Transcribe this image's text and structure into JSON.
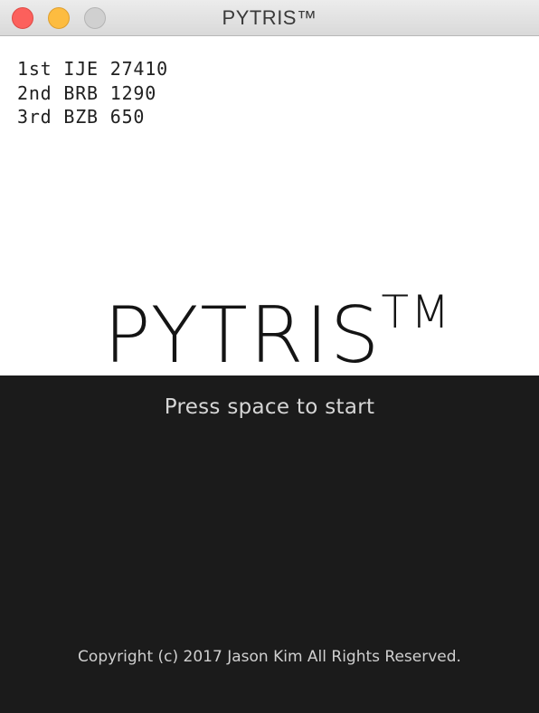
{
  "window": {
    "title": "PYTRIS™",
    "controls": {
      "close_icon": "red-close-circle",
      "minimize_icon": "yellow-minimize-circle",
      "zoom_icon": "gray-zoom-circle"
    }
  },
  "high_scores": [
    {
      "rank": "1st",
      "initials": "IJE",
      "score": "27410",
      "line": "1st IJE 27410"
    },
    {
      "rank": "2nd",
      "initials": "BRB",
      "score": "1290",
      "line": "2nd BRB 1290"
    },
    {
      "rank": "3rd",
      "initials": "BZB",
      "score": "650",
      "line": "3rd BZB 650"
    }
  ],
  "logo": {
    "text": "PYTRIS",
    "trademark": "TM"
  },
  "prompt": "Press space to start",
  "copyright": "Copyright (c) 2017 Jason Kim All Rights Reserved.",
  "colors": {
    "top_background": "#ffffff",
    "bottom_background": "#1b1b1b",
    "prompt_text": "#d6d6d6",
    "close": "#fc605c",
    "minimize": "#fdbc40",
    "zoom": "#d0d0d0"
  }
}
